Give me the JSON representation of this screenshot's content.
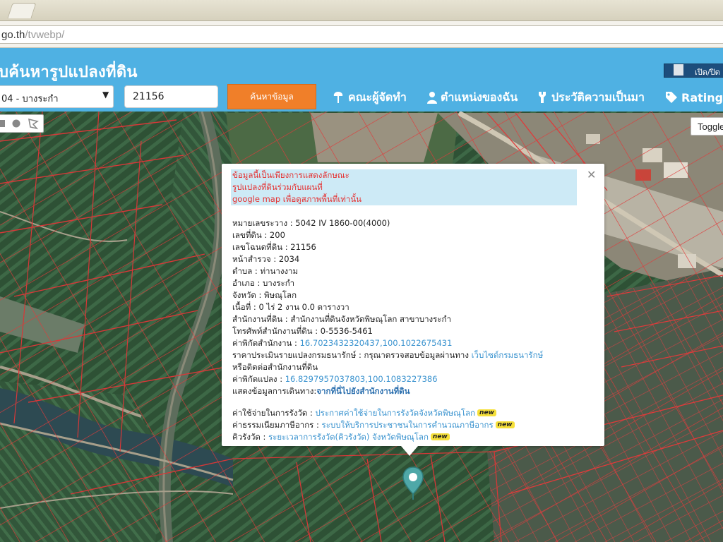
{
  "browser": {
    "url_host": "go.th",
    "url_path": "/tvwebp/",
    "tab_title": ""
  },
  "header": {
    "title": "บค้นหารูปแปลงที่ดิน",
    "toggle_label": "เปิด/ปิด",
    "district_value": "04 - บางระกำ",
    "parcel_value": "21156",
    "search_label": "ค้นหาข้อมูล",
    "nav": {
      "staff": "คณะผู้จัดทำ",
      "location": "ตำแหน่งของฉัน",
      "history": "ประวัติความเป็นมา",
      "rating": "Rating"
    }
  },
  "map": {
    "toggle_label": "Toggle"
  },
  "popup": {
    "disclaimer": [
      "ข้อมูลนี้เป็นเพียงการแสดงลักษณะ",
      "รูปแปลงที่ดินร่วมกับแผนที่",
      "google map เพื่อดูสภาพพื้นที่เท่านั้น"
    ],
    "map_sheet": "หมายเลขระวาง : 5042 IV 1860-00(4000)",
    "land_no": "เลขที่ดิน : 200",
    "deed_no": "เลขโฉนดที่ดิน : 21156",
    "survey_page": "หน้าสำรวจ : 2034",
    "subdistrict": "ตำบล : ท่านางงาม",
    "district": "อำเภอ : บางระกำ",
    "province": "จังหวัด : พิษณุโลก",
    "area": "เนื้อที่ : 0 ไร่ 2 งาน 0.0 ตารางวา",
    "office": "สำนักงานที่ดิน : สำนักงานที่ดินจังหวัดพิษณุโลก สาขาบางระกำ",
    "office_phone": "โทรศัพท์สำนักงานที่ดิน : 0-5536-5461",
    "office_coord_label": "ค่าพิกัดสำนักงาน : ",
    "office_coord": "16.7023432320437,100.1022675431",
    "appraisal_label": "ราคาประเมินรายแปลงกรมธนารักษ์ : กรุณาตรวจสอบข้อมูลผ่านทาง ",
    "appraisal_link": "เว็บไซต์กรมธนารักษ์",
    "appraisal_contact": "หรือติดต่อสำนักงานที่ดิน",
    "parcel_coord_label": "ค่าพิกัดแปลง : ",
    "parcel_coord": "16.8297957037803,100.1083227386",
    "directions_label": "แสดงข้อมูลการเดินทาง:",
    "directions_link": "จากที่นี่ไปยังสำนักงานที่ดิน",
    "fee_label": "ค่าใช้จ่ายในการรังวัด : ",
    "fee_link": "ประกาศค่าใช้จ่ายในการรังวัดจังหวัดพิษณุโลก",
    "tax_label": "ค่าธรรมเนียมภาษีอากร : ",
    "tax_link": "ระบบให้บริการประชาชนในการคำนวณภาษีอากร",
    "queue_label": "คิวรังวัด : ",
    "queue_link": "ระยะเวลาการรังวัด(คิวรังวัด) จังหวัดพิษณุโลก",
    "new_badge": "new"
  },
  "colors": {
    "header_bg": "#4fb1e3",
    "search_button": "#f07f29",
    "parcel_lines": "#e03a3a",
    "marker": "#4fa8a8"
  }
}
